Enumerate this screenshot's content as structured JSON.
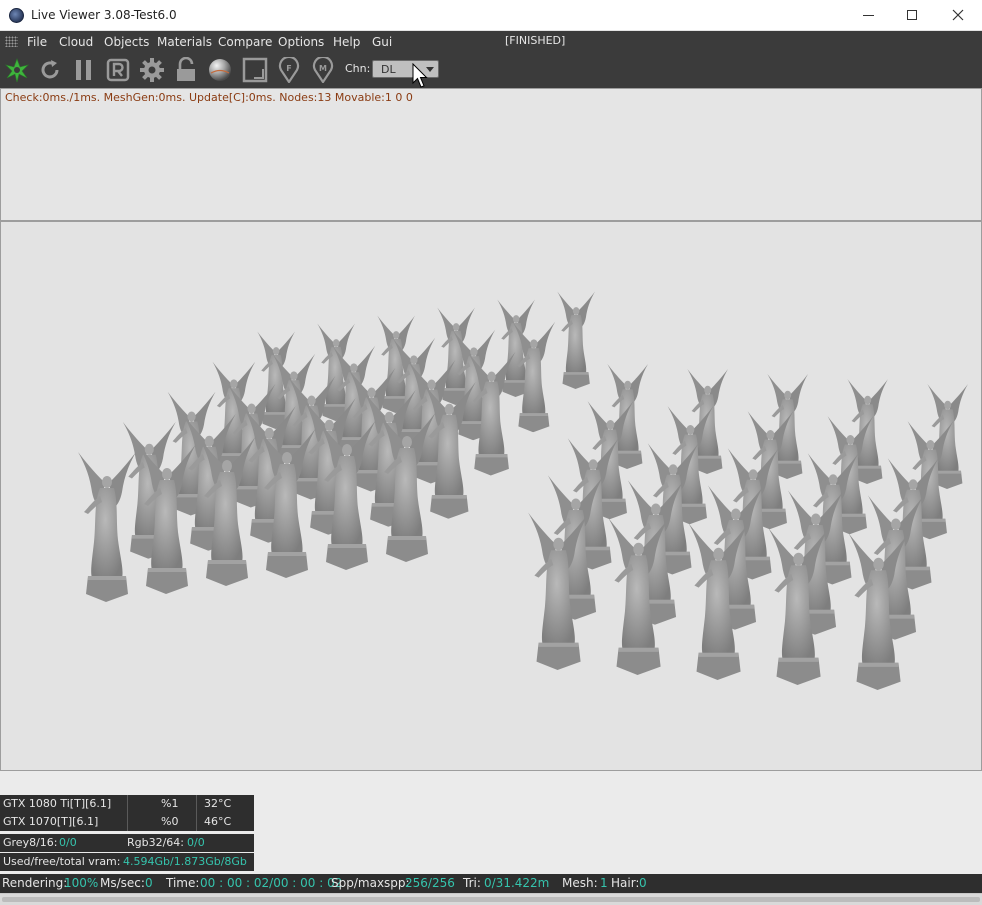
{
  "window": {
    "title": "Live Viewer 3.08-Test6.0",
    "controls": {
      "minimize": "minimize-icon",
      "maximize": "maximize-icon",
      "close": "close-icon"
    }
  },
  "menu": {
    "items": [
      "File",
      "Cloud",
      "Objects",
      "Materials",
      "Compare",
      "Options",
      "Help",
      "Gui"
    ],
    "status": "[FINISHED]"
  },
  "toolbar": {
    "icons": [
      "octane-logo-icon",
      "refresh-icon",
      "pause-icon",
      "region-render-icon",
      "settings-gear-icon",
      "unlock-icon",
      "material-ball-icon",
      "focus-picker-icon",
      "focus-pin-icon",
      "material-pin-icon"
    ],
    "channel_label": "Chn:",
    "channel_value": "DL"
  },
  "info": {
    "line": "Check:0ms./1ms. MeshGen:0ms. Update[C]:0ms. Nodes:13 Movable:1  0 0"
  },
  "gpus": [
    {
      "name": "GTX 1080 Ti[T][6.1]",
      "usage": "%1",
      "temp": "32°C"
    },
    {
      "name": "GTX 1070[T][6.1]",
      "usage": "%0",
      "temp": "46°C"
    }
  ],
  "memory": {
    "grey_label": "Grey8/16:",
    "grey_value": "0/0",
    "rgb_label": "Rgb32/64:",
    "rgb_value": "0/0",
    "vram_label": "Used/free/total vram:",
    "vram_value": "4.594Gb/1.873Gb/8Gb"
  },
  "status": {
    "rendering_label": "Rendering:",
    "rendering_value": "100%",
    "ms_label": "Ms/sec:",
    "ms_value": "0",
    "time_label": "Time:",
    "time_value": "00 : 00 : 02/00 : 00 : 02",
    "spp_label": "Spp/maxspp:",
    "spp_value": "256/256",
    "tri_label": "Tri:",
    "tri_value": "0/31.422m",
    "mesh_label": "Mesh:",
    "mesh_value": "1",
    "hair_label": "Hair:",
    "hair_value": "0"
  },
  "colors": {
    "accent_teal": "#35c4ad",
    "info_text": "#8a3b12",
    "dark_bar": "#3b3b3b",
    "viewport_bg": "#e3e3e3"
  }
}
